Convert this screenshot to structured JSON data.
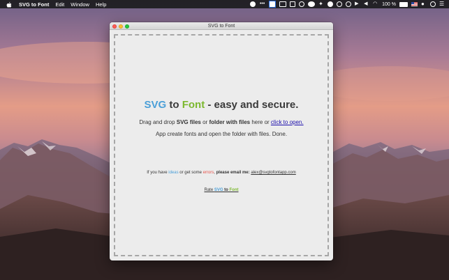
{
  "menubar": {
    "app_name": "SVG to Font",
    "items": [
      "Edit",
      "Window",
      "Help"
    ],
    "battery": "100 %"
  },
  "window": {
    "title": "SVG to Font"
  },
  "headline": {
    "svg": "SVG",
    "to": " to ",
    "font": "Font",
    "rest": " - easy and secure."
  },
  "instructions": {
    "pre": "Drag and drop ",
    "svg_files": "SVG files",
    "or": " or ",
    "folder": "folder with files",
    "here": " here or ",
    "link": "click to open."
  },
  "subtext": "App create fonts and open the folder with files. Done.",
  "contact": {
    "pre": "If you have ",
    "ideas": "ideas",
    "mid": " or get some ",
    "errors": "errors",
    "comma": ", ",
    "please": "please email me:",
    "email": "alex@svgtofontapp.com"
  },
  "rate": {
    "pre": "Rate ",
    "svg": "SVG",
    "to": " to ",
    "font": "Font"
  },
  "colors": {
    "svg_blue": "#4a9fd8",
    "font_green": "#7cb82f",
    "error_red": "#e8534b",
    "link": "#1a0dab"
  }
}
